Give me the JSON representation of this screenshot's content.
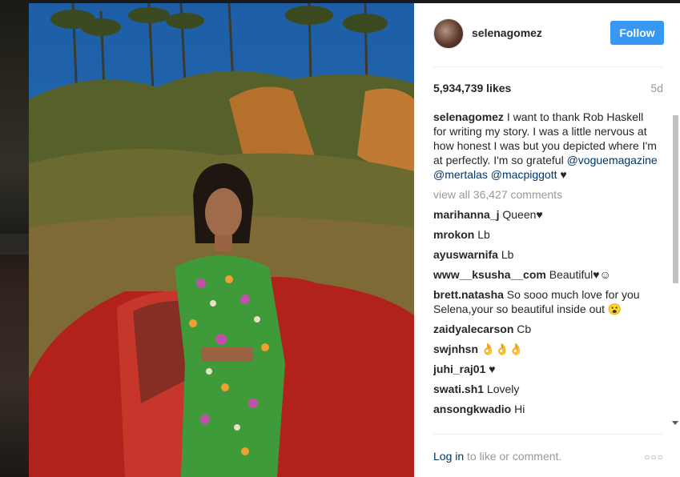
{
  "post": {
    "username": "selenagomez",
    "follow_label": "Follow",
    "likes": "5,934,739 likes",
    "age": "5d",
    "caption": {
      "username": "selenagomez",
      "text": " I want to thank Rob Haskell for writing my story. I was a little nervous at how honest I was but you depicted where I'm at perfectly. I'm so grateful ",
      "tag1": "@voguemagazine",
      "tag2": "@mertalas",
      "tag3": "@macpiggott",
      "tail": " ♥"
    },
    "view_all": "view all 36,427 comments",
    "comments": [
      {
        "user": "marihanna_j",
        "text": " Queen♥"
      },
      {
        "user": "mrokon",
        "text": " Lb"
      },
      {
        "user": "ayuswarnifa",
        "text": " Lb"
      },
      {
        "user": "www__ksusha__com",
        "text": " Beautiful♥☺"
      },
      {
        "user": "brett.natasha",
        "text": " So sooo much love for you Selena,your so beautiful inside out 😮"
      },
      {
        "user": "zaidyalecarson",
        "text": " Cb"
      },
      {
        "user": "swjnhsn",
        "text": " 👌👌👌"
      },
      {
        "user": "juhi_raj01",
        "text": " ♥"
      },
      {
        "user": "swati.sh1",
        "text": " Lovely"
      },
      {
        "user": "ansongkwadio",
        "text": " Hi"
      }
    ],
    "footer": {
      "login_label": "Log in",
      "rest": " to like or comment."
    },
    "more_icon": "ellipsis-icon"
  },
  "colors": {
    "follow_bg": "#3897f0",
    "link": "#003569",
    "muted": "#999999",
    "text": "#262626"
  }
}
